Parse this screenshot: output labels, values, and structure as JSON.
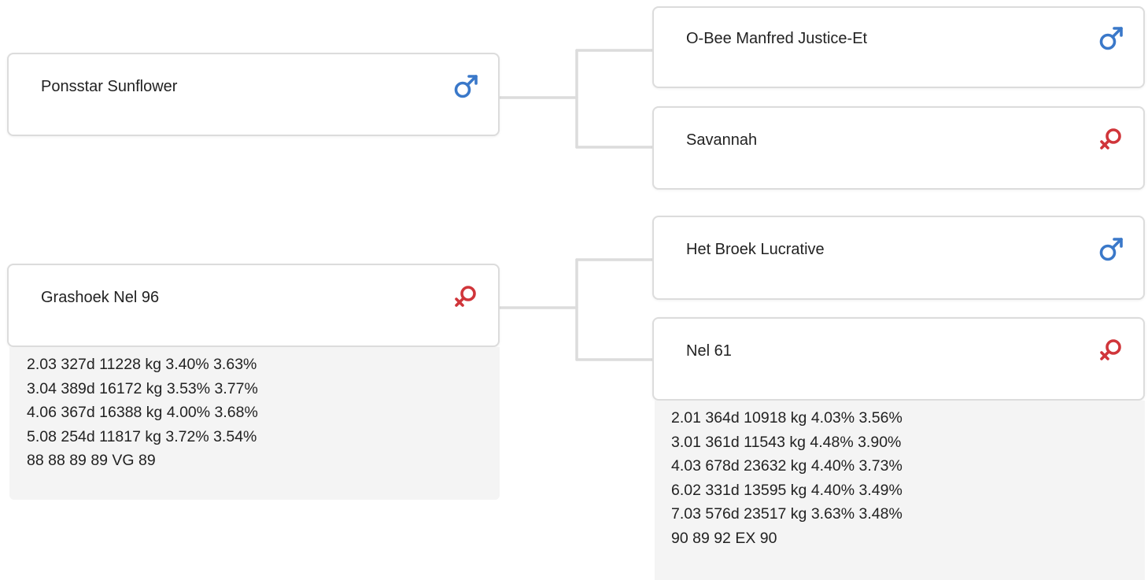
{
  "colors": {
    "male": "#3a78c9",
    "female": "#d0353a",
    "card_border": "#dcdcdc",
    "connector": "#dcdcdc",
    "performance_bg": "#f4f4f4"
  },
  "pedigree": {
    "sire": {
      "name": "Ponsstar Sunflower",
      "sex": "male",
      "sire": {
        "name": "O-Bee Manfred Justice-Et",
        "sex": "male"
      },
      "dam": {
        "name": "Savannah",
        "sex": "female"
      }
    },
    "dam": {
      "name": "Grashoek Nel 96",
      "sex": "female",
      "performance": [
        "2.03 327d 11228 kg 3.40% 3.63%",
        "3.04 389d 16172 kg 3.53% 3.77%",
        "4.06 367d 16388 kg 4.00% 3.68%",
        "5.08 254d 11817 kg 3.72% 3.54%",
        "88 88 89 89 VG 89"
      ],
      "sire": {
        "name": "Het Broek Lucrative",
        "sex": "male"
      },
      "dam": {
        "name": "Nel 61",
        "sex": "female",
        "performance": [
          "2.01 364d 10918 kg 4.03% 3.56%",
          "3.01 361d 11543 kg 4.48% 3.90%",
          "4.03 678d 23632 kg 4.40% 3.73%",
          "6.02 331d 13595 kg 4.40% 3.49%",
          "7.03 576d 23517 kg 3.63% 3.48%",
          "90 89 92 EX 90"
        ]
      }
    }
  }
}
